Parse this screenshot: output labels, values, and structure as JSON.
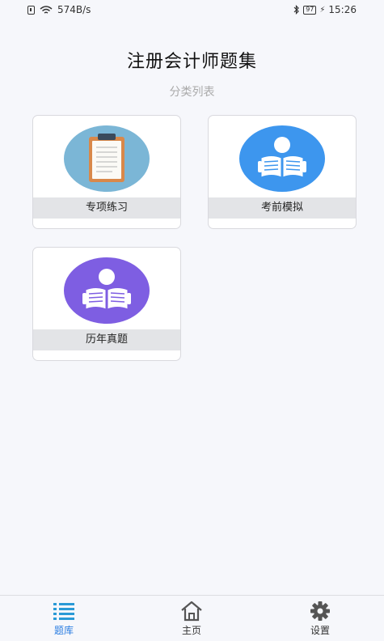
{
  "status_bar": {
    "net_speed": "574B/s",
    "battery": "97",
    "time": "15:26"
  },
  "header": {
    "title": "注册会计师题集",
    "subtitle": "分类列表"
  },
  "categories": [
    {
      "label": "专项练习",
      "icon": "clipboard-icon",
      "color": "#7bb6d6"
    },
    {
      "label": "考前模拟",
      "icon": "reader-icon",
      "color": "#3d96ee"
    },
    {
      "label": "历年真题",
      "icon": "reader-icon",
      "color": "#7e5ee2"
    }
  ],
  "nav": {
    "items": [
      {
        "label": "题库",
        "icon": "list-icon",
        "active": true
      },
      {
        "label": "主页",
        "icon": "home-icon",
        "active": false
      },
      {
        "label": "设置",
        "icon": "gear-icon",
        "active": false
      }
    ],
    "active_color": "#2a7de1",
    "inactive_color": "#555555"
  }
}
